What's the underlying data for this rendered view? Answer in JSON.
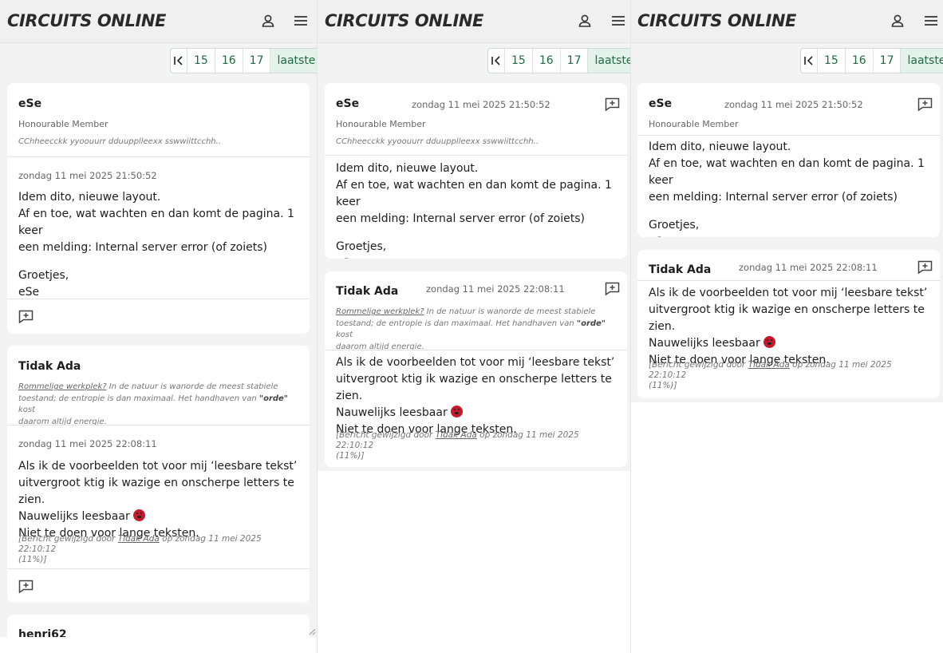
{
  "site": {
    "logo": "CIRCUITS ONLINE"
  },
  "pager": {
    "pages": [
      "15",
      "16",
      "17"
    ],
    "last_label": "laatste"
  },
  "posts": [
    {
      "author": "eSe",
      "rank": "Honourable Member",
      "signature": "CChheecckk yyoouurr dduupplleexx sswwiittcchh..",
      "date": "zondag 11 mei 2025 21:50:52",
      "lines": [
        "Idem dito, nieuwe layout.",
        "Af en toe, wat wachten en dan komt de pagina. 1 keer",
        "een melding: Internal server error (of zoiets)"
      ],
      "greeting": [
        "Groetjes,",
        "eSe"
      ]
    },
    {
      "author": "Tidak Ada",
      "signature_link": "Rommelige werkplek?",
      "signature_text_1": " In de natuur is wanorde de meest stabiele",
      "signature_text_2": "toestand; de entropie is dan maximaal. Het handhaven van ",
      "signature_bold": "\"orde\"",
      "signature_text_3": " kost",
      "signature_text_4": "daarom altijd energie.",
      "date": "zondag 11 mei 2025 22:08:11",
      "lines": [
        "Als ik de voorbeelden tot voor mij ‘leesbare tekst’",
        "uitvergroot ktig ik wazige en onscherpe letters te zien.",
        "Nauwelijks leesbaar",
        "Niet te doen voor lange teksten."
      ],
      "edit_prefix": "[Bericht gewijzigd door ",
      "edit_author": "Tidak Ada",
      "edit_suffix": " op zondag 11 mei 2025 22:10:12",
      "edit_suffix2": "(11%)]"
    }
  ],
  "next_author": "henri62",
  "icons": [
    "user-icon",
    "menu-icon",
    "first-page-icon",
    "reply-icon",
    "angry-emoji-icon"
  ]
}
